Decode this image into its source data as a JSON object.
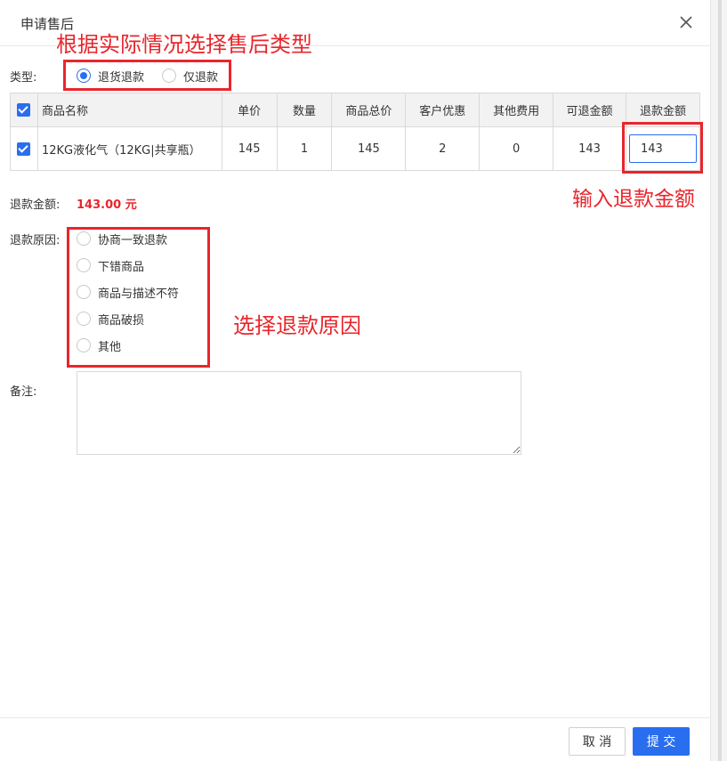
{
  "dialog": {
    "title": "申请售后",
    "cancel_label": "取 消",
    "submit_label": "提 交"
  },
  "annotations": {
    "type_hint": "根据实际情况选择售后类型",
    "amount_hint": "输入退款金额",
    "reason_hint": "选择退款原因"
  },
  "type_field": {
    "label": "类型:",
    "options": [
      {
        "label": "退货退款",
        "checked": true
      },
      {
        "label": "仅退款",
        "checked": false
      }
    ]
  },
  "table": {
    "headers": [
      "商品名称",
      "单价",
      "数量",
      "商品总价",
      "客户优惠",
      "其他费用",
      "可退金额",
      "退款金额"
    ],
    "rows": [
      {
        "name": "12KG液化气（12KG|共享瓶）",
        "price": "145",
        "qty": "1",
        "total": "145",
        "discount": "2",
        "other_fee": "0",
        "refundable": "143",
        "refund_value": "143"
      }
    ]
  },
  "refund_amount": {
    "label": "退款金额:",
    "value": "143.00 元"
  },
  "reason_field": {
    "label": "退款原因:",
    "options": [
      "协商一致退款",
      "下错商品",
      "商品与描述不符",
      "商品破损",
      "其他"
    ]
  },
  "remark": {
    "label": "备注:",
    "value": ""
  },
  "colors": {
    "accent": "#2a6ef0",
    "annotation": "#e8262c"
  }
}
